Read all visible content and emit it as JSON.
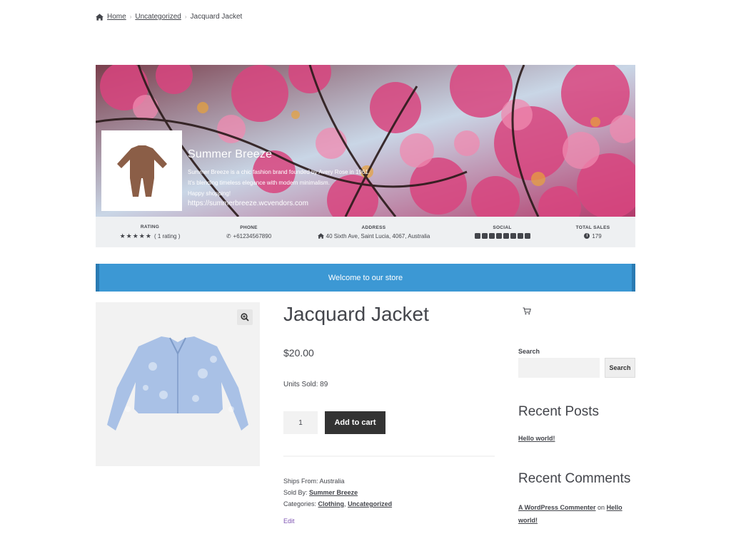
{
  "breadcrumb": {
    "home": "Home",
    "category": "Uncategorized",
    "current": "Jacquard Jacket"
  },
  "vendor": {
    "name": "Summer Breeze",
    "description_lines": [
      "Summer Breeze is a chic fashion brand founded by Avery Rose in 1961.",
      "It's blending timeless elegance with modern minimalism.",
      "Happy shopping!"
    ],
    "url": "https://summerbreeze.wcvendors.com",
    "meta": {
      "rating_label": "RATING",
      "stars": "★★★★★",
      "rating_text": "( 1 rating )",
      "phone_label": "PHONE",
      "phone": "+61234567890",
      "address_label": "ADDRESS",
      "address": "40 Sixth Ave, Saint Lucia, 4067, Australia",
      "social_label": "SOCIAL",
      "social_icons": [
        "twitter-icon",
        "instagram-icon",
        "facebook-icon",
        "linkedin-icon",
        "youtube-icon",
        "pinterest-icon",
        "snapchat-icon",
        "telegram-icon"
      ],
      "sales_label": "TOTAL SALES",
      "sales": "179"
    }
  },
  "welcome": "Welcome to our store",
  "product": {
    "title": "Jacquard Jacket",
    "price": "$20.00",
    "units_sold": "Units Sold: 89",
    "quantity": "1",
    "add_to_cart": "Add to cart",
    "ships_from_label": "Ships From:",
    "ships_from": "Australia",
    "sold_by_label": "Sold By:",
    "sold_by": "Summer Breeze",
    "categories_label": "Categories:",
    "category_1": "Clothing",
    "category_2": "Uncategorized",
    "edit": "Edit"
  },
  "sidebar": {
    "search_label": "Search",
    "search_button": "Search",
    "recent_posts_title": "Recent Posts",
    "recent_post_1": "Hello world!",
    "recent_comments_title": "Recent Comments",
    "comment_author": "A WordPress Commenter",
    "comment_on": "on",
    "comment_post_a": "Hello",
    "comment_post_b": "world!"
  },
  "colors": {
    "accent_blue": "#3c98d4",
    "button_dark": "#333333",
    "edit_link": "#7f54b3"
  }
}
